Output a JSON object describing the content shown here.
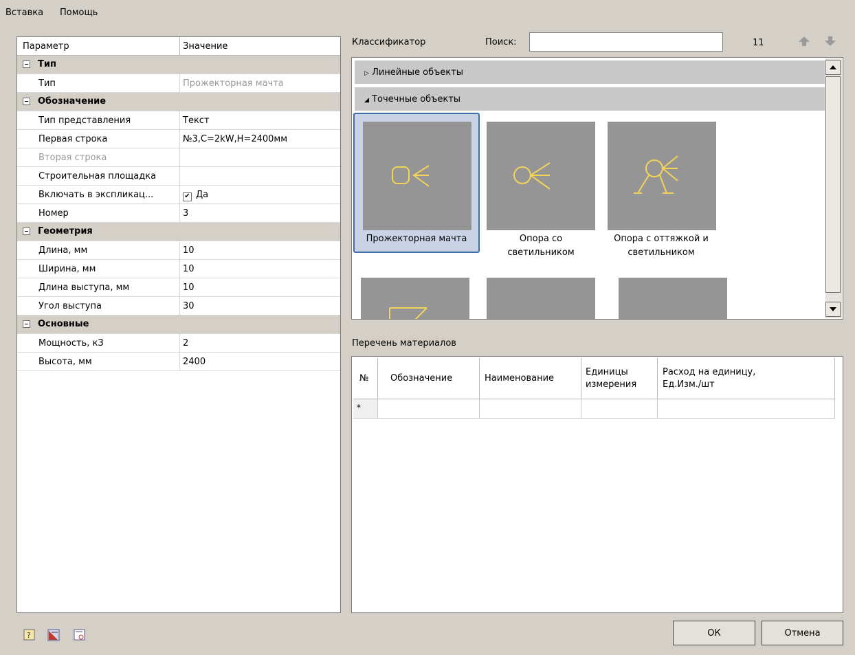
{
  "menu": {
    "items": [
      "Вставка",
      "Помощь"
    ]
  },
  "props": {
    "col_param": "Параметр",
    "col_value": "Значение",
    "rows": [
      {
        "kind": "cat",
        "name": "Тип"
      },
      {
        "kind": "item",
        "name": "Тип",
        "value": "Прожекторная мачта",
        "value_muted": true
      },
      {
        "kind": "cat",
        "name": "Обозначение"
      },
      {
        "kind": "item",
        "name": "Тип представления",
        "value": "Текст"
      },
      {
        "kind": "item",
        "name": "Первая строка",
        "value": "№3,С=2kW,Н=2400мм"
      },
      {
        "kind": "item",
        "name": "Вторая строка",
        "value": "",
        "name_muted": true
      },
      {
        "kind": "item",
        "name": "Строительная площадка",
        "value": ""
      },
      {
        "kind": "item",
        "name": "Включать в экспликац...",
        "value": "Да",
        "checked": true
      },
      {
        "kind": "item",
        "name": "Номер",
        "value": "3"
      },
      {
        "kind": "cat",
        "name": "Геометрия"
      },
      {
        "kind": "item",
        "name": "Длина, мм",
        "value": "10"
      },
      {
        "kind": "item",
        "name": "Ширина, мм",
        "value": "10"
      },
      {
        "kind": "item",
        "name": "Длина выступа, мм",
        "value": "10"
      },
      {
        "kind": "item",
        "name": "Угол выступа",
        "value": "30"
      },
      {
        "kind": "cat",
        "name": "Основные"
      },
      {
        "kind": "item",
        "name": "Мощность, кЗ",
        "value": "2"
      },
      {
        "kind": "item",
        "name": "Высота, мм",
        "value": "2400"
      }
    ]
  },
  "classifier": {
    "label": "Классификатор",
    "search_label": "Поиск:",
    "search_value": "",
    "count": "11",
    "groups": [
      {
        "label": "Линейные объекты",
        "expanded": false
      },
      {
        "label": "Точечные объекты",
        "expanded": true
      }
    ],
    "tiles": [
      {
        "label_lines": [
          "Прожекторная мачта"
        ],
        "selected": true,
        "symbol": "floodlight-mast"
      },
      {
        "label_lines": [
          "Опора со",
          "светильником"
        ],
        "selected": false,
        "symbol": "pole-with-lamp"
      },
      {
        "label_lines": [
          "Опора с оттяжкой и",
          "светильником"
        ],
        "selected": false,
        "symbol": "pole-with-guy-and-lamp"
      }
    ],
    "symbol_color": "#f2d45a"
  },
  "materials": {
    "title": "Перечень материалов",
    "columns": [
      "№",
      "Обозначение",
      "Наименование",
      "Единицы измерения",
      "Расход на единицу, Ед.Изм./шт"
    ],
    "column_lines": [
      [
        "№"
      ],
      [
        "Обозначение"
      ],
      [
        "Наименование"
      ],
      [
        "Единицы",
        "измерения"
      ],
      [
        "Расход на единицу,",
        "Ед.Изм./шт"
      ]
    ],
    "new_row_marker": "*"
  },
  "buttons": {
    "ok": "ОК",
    "cancel": "Отмена"
  },
  "toolbar_icons": [
    "help-icon",
    "report-icon",
    "settings-icon"
  ],
  "colors": {
    "selection_border": "#3d6ea8",
    "selection_fill": "#c9d3e5",
    "tile_bg": "#959595"
  }
}
